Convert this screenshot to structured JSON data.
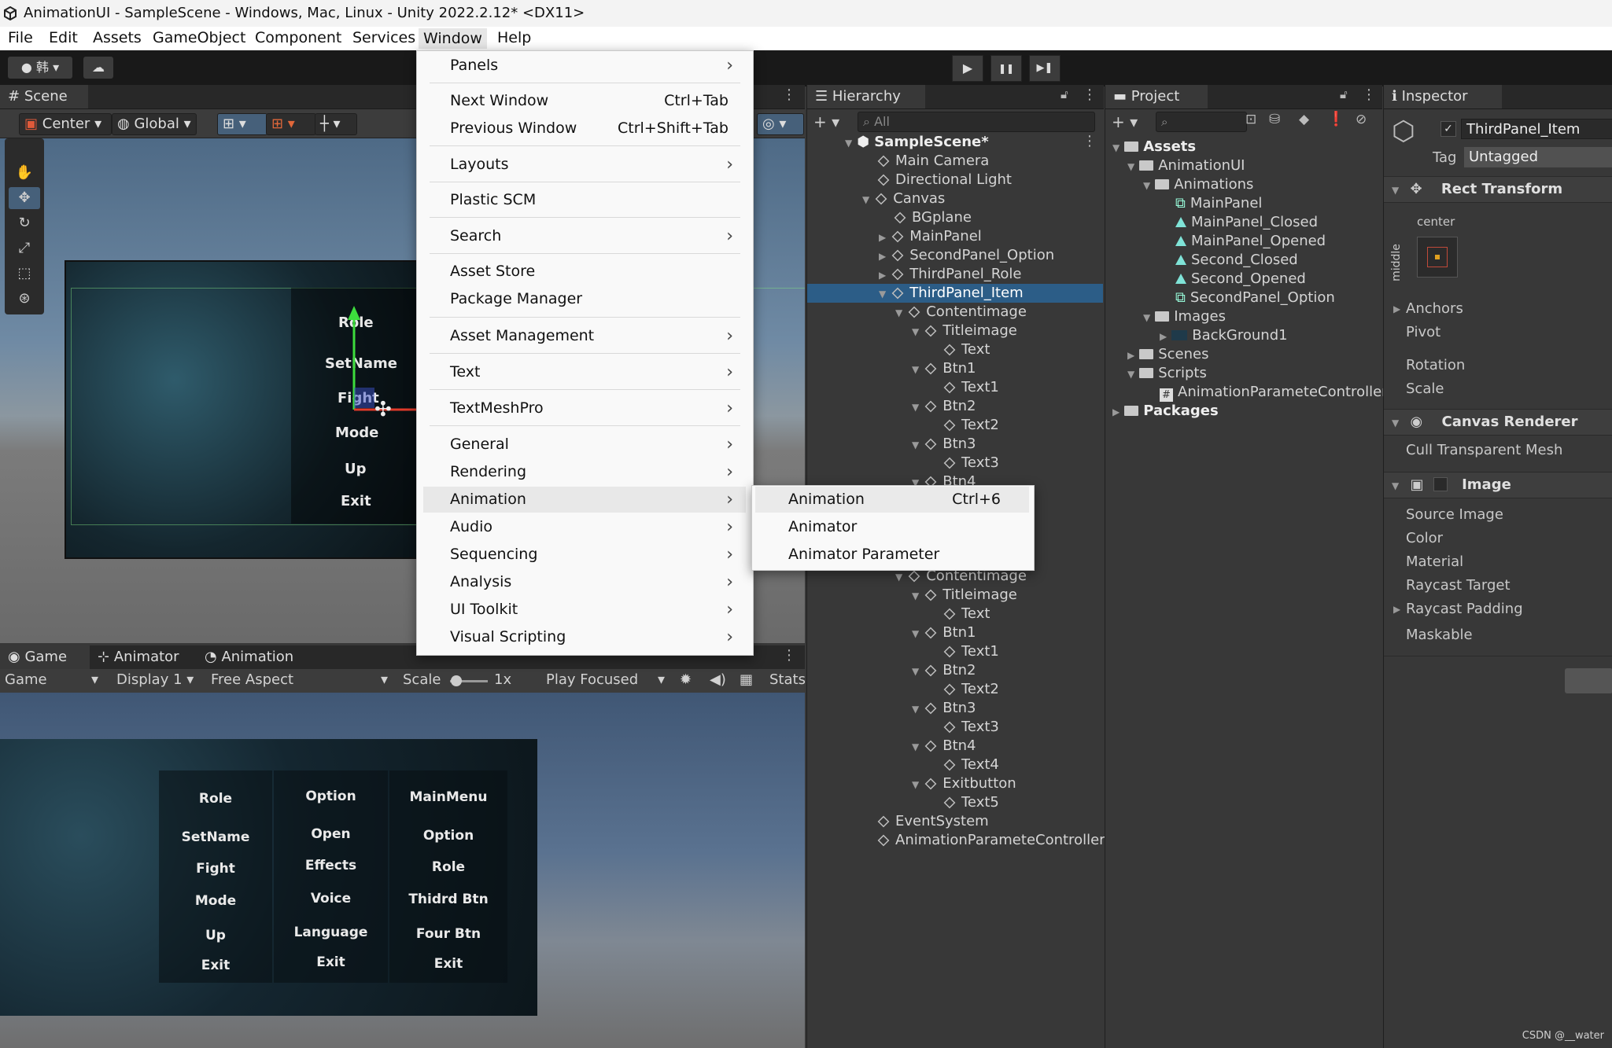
{
  "window": {
    "title": "AnimationUI - SampleScene - Windows, Mac, Linux - Unity 2022.2.12* <DX11>"
  },
  "menubar": [
    "File",
    "Edit",
    "Assets",
    "GameObject",
    "Component",
    "Services",
    "Window",
    "Help"
  ],
  "toolbar": {
    "account": "韩",
    "play": "▶",
    "pause": "❚❚",
    "step": "▶❚"
  },
  "scene": {
    "tab": "Scene",
    "center": "Center",
    "global": "Global",
    "labels": [
      "Role",
      "SetName",
      "Fight",
      "Mode",
      "Up",
      "Exit"
    ]
  },
  "game": {
    "tabs": [
      "Game",
      "Animator",
      "Animation"
    ],
    "bar": {
      "game": "Game",
      "display": "Display 1",
      "aspect": "Free Aspect",
      "scale_label": "Scale",
      "scale_value": "1x",
      "play_focused": "Play Focused",
      "stats": "Stats"
    },
    "col1": [
      "Role",
      "SetName",
      "Fight",
      "Mode",
      "Up",
      "Exit"
    ],
    "col2": [
      "Option",
      "Open",
      "Effects",
      "Voice",
      "Language",
      "Exit"
    ],
    "col3": [
      "MainMenu",
      "Option",
      "Role",
      "Thidrd Btn",
      "Four Btn",
      "Exit"
    ]
  },
  "hierarchy": {
    "tab": "Hierarchy",
    "search_placeholder": "All",
    "scene": "SampleScene*",
    "items": [
      "Main Camera",
      "Directional Light",
      "Canvas",
      "BGplane",
      "MainPanel",
      "SecondPanel_Option",
      "ThirdPanel_Role",
      "ThirdPanel_Item",
      "Contentimage",
      "Titleimage",
      "Text",
      "Btn1",
      "Text1",
      "Btn2",
      "Text2",
      "Btn3",
      "Text3",
      "Btn4"
    ],
    "items_lower": [
      "Contentimage",
      "Titleimage",
      "Text",
      "Btn1",
      "Text1",
      "Btn2",
      "Text2",
      "Btn3",
      "Text3",
      "Btn4",
      "Text4",
      "Exitbutton",
      "Text5",
      "EventSystem",
      "AnimationParameteController"
    ]
  },
  "project": {
    "tab": "Project",
    "items": [
      "Assets",
      "AnimationUI",
      "Animations",
      "MainPanel",
      "MainPanel_Closed",
      "MainPanel_Opened",
      "Second_Closed",
      "Second_Opened",
      "SecondPanel_Option",
      "Images",
      "BackGround1",
      "Scenes",
      "Scripts",
      "AnimationParameteController",
      "Packages"
    ]
  },
  "inspector": {
    "tab": "Inspector",
    "object_name": "ThirdPanel_Item",
    "tag_label": "Tag",
    "tag_value": "Untagged",
    "rect_transform": "Rect Transform",
    "anchor_h": "center",
    "anchor_v": "middle",
    "rect_props": [
      "Anchors",
      "Pivot",
      "Rotation",
      "Scale"
    ],
    "canvas_renderer": "Canvas Renderer",
    "cull": "Cull Transparent Mesh",
    "image": "Image",
    "image_props": [
      "Source Image",
      "Color",
      "Material",
      "Raycast Target",
      "Raycast Padding",
      "Maskable"
    ]
  },
  "window_menu": [
    {
      "label": "Panels",
      "shortcut": "",
      "sub": true
    },
    {
      "label": "Next Window",
      "shortcut": "Ctrl+Tab",
      "sub": false
    },
    {
      "label": "Previous Window",
      "shortcut": "Ctrl+Shift+Tab",
      "sub": false
    },
    {
      "label": "Layouts",
      "shortcut": "",
      "sub": true
    },
    {
      "label": "Plastic SCM",
      "shortcut": "",
      "sub": false
    },
    {
      "label": "Search",
      "shortcut": "",
      "sub": true
    },
    {
      "label": "Asset Store",
      "shortcut": "",
      "sub": false
    },
    {
      "label": "Package Manager",
      "shortcut": "",
      "sub": false
    },
    {
      "label": "Asset Management",
      "shortcut": "",
      "sub": true
    },
    {
      "label": "Text",
      "shortcut": "",
      "sub": true
    },
    {
      "label": "TextMeshPro",
      "shortcut": "",
      "sub": true
    },
    {
      "label": "General",
      "shortcut": "",
      "sub": true
    },
    {
      "label": "Rendering",
      "shortcut": "",
      "sub": true
    },
    {
      "label": "Animation",
      "shortcut": "",
      "sub": true
    },
    {
      "label": "Audio",
      "shortcut": "",
      "sub": true
    },
    {
      "label": "Sequencing",
      "shortcut": "",
      "sub": true
    },
    {
      "label": "Analysis",
      "shortcut": "",
      "sub": true
    },
    {
      "label": "UI Toolkit",
      "shortcut": "",
      "sub": true
    },
    {
      "label": "Visual Scripting",
      "shortcut": "",
      "sub": true
    }
  ],
  "animation_submenu": [
    {
      "label": "Animation",
      "shortcut": "Ctrl+6"
    },
    {
      "label": "Animator",
      "shortcut": ""
    },
    {
      "label": "Animator Parameter",
      "shortcut": ""
    }
  ],
  "watermark": "CSDN @__water",
  "colors": {
    "selection": "#2c5d87",
    "menu_highlight": "#e8e8e8",
    "accent_green": "#3ddc3d"
  }
}
